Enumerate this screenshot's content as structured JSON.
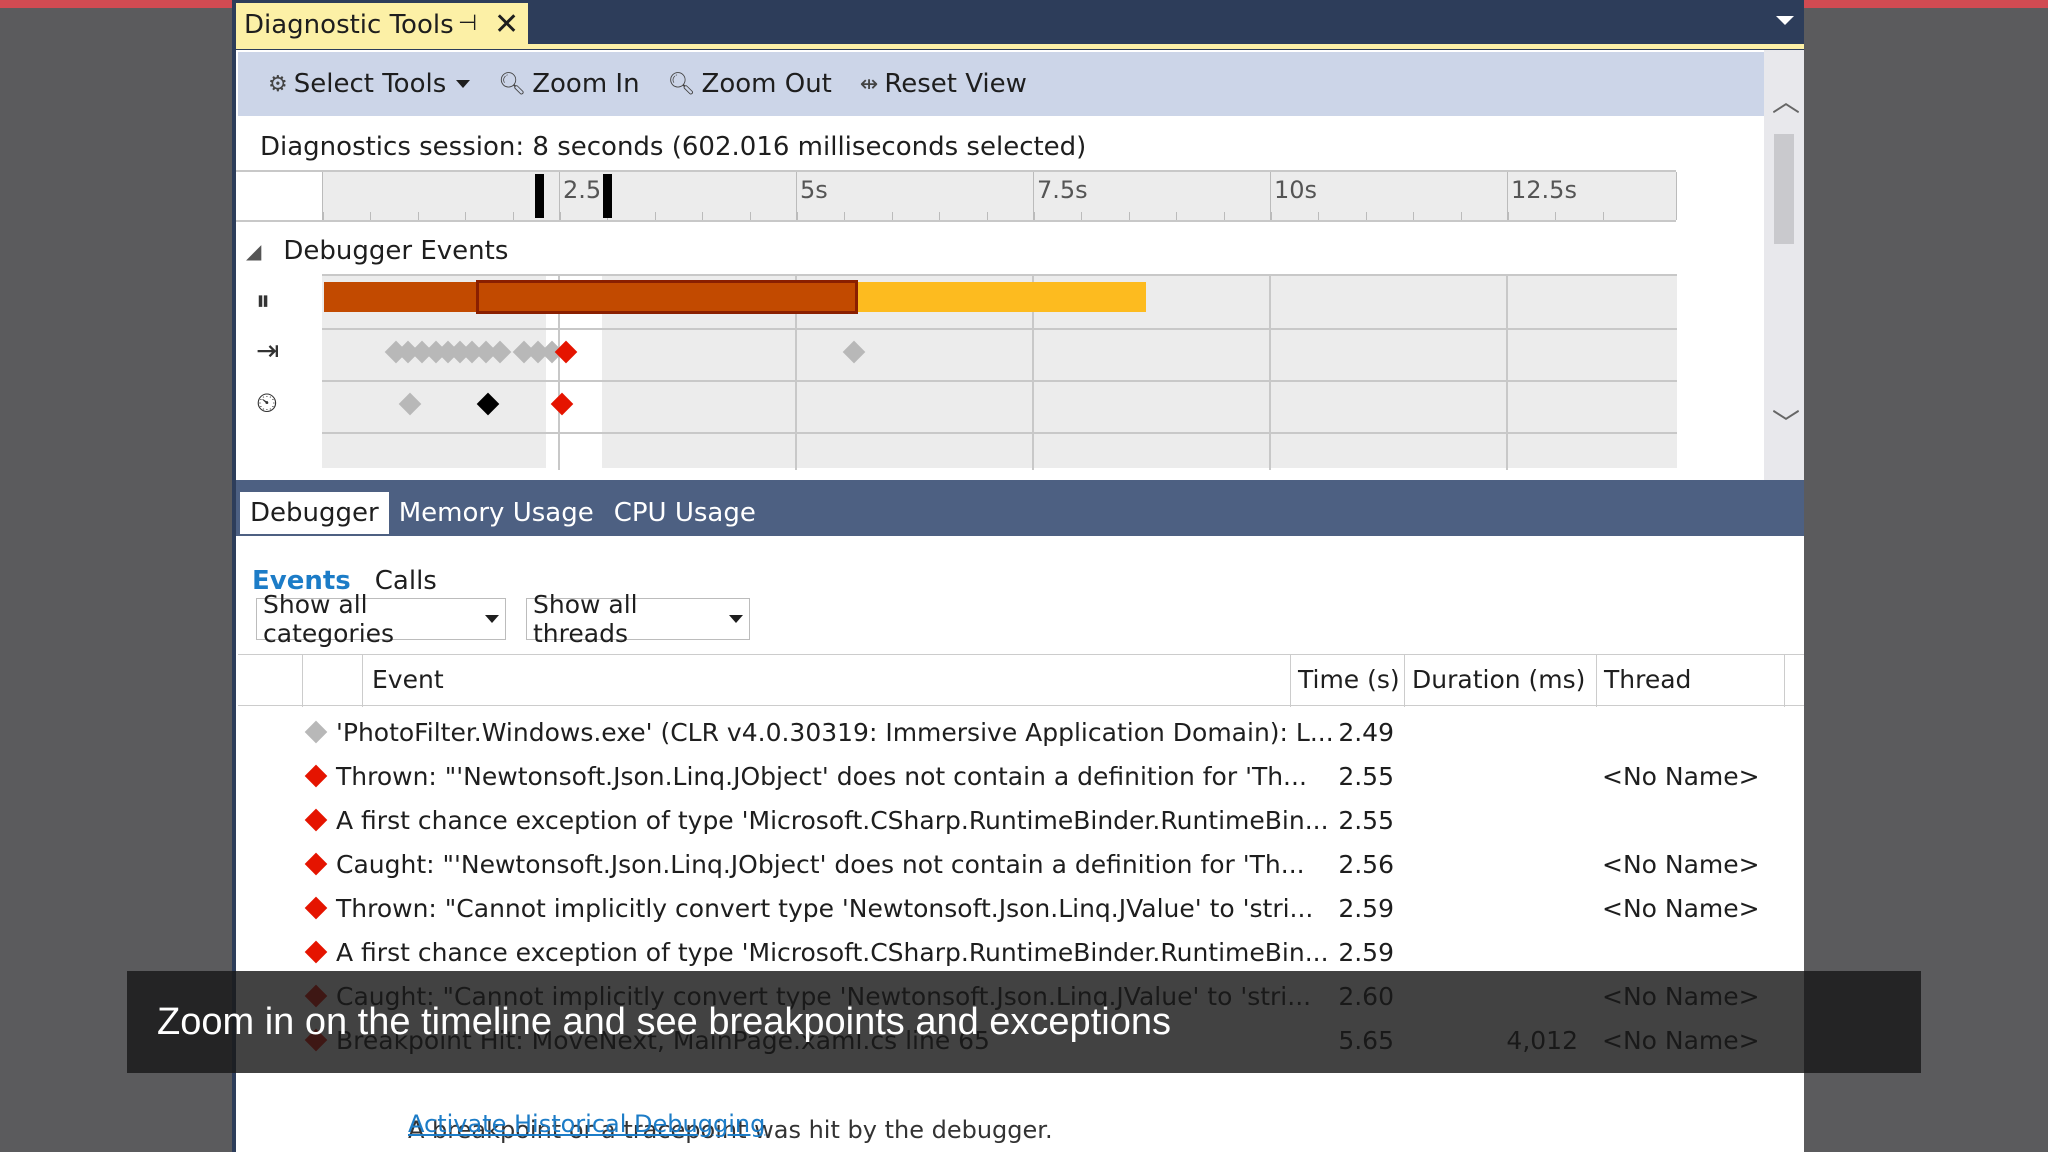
{
  "window": {
    "tab_title": "Diagnostic Tools",
    "pin_glyph": "⊣",
    "close_glyph": "✕"
  },
  "toolbar": {
    "select_tools": "Select Tools",
    "zoom_in": "Zoom In",
    "zoom_out": "Zoom Out",
    "reset_view": "Reset View"
  },
  "session": "Diagnostics session: 8 seconds (602.016 milliseconds selected)",
  "ruler": {
    "labels": [
      "2.5",
      "5s",
      "7.5s",
      "10s",
      "12.5s"
    ]
  },
  "debugger_events": {
    "header": "Debugger Events",
    "colors": {
      "break": "#c24a00",
      "running": "#fdbb1f",
      "exception": "#e51400",
      "info": "#b8b8b8",
      "breakpoint": "#000000"
    }
  },
  "bottom_tabs": [
    "Debugger",
    "Memory Usage",
    "CPU Usage"
  ],
  "sub_tabs": {
    "events": "Events",
    "calls": "Calls"
  },
  "filters": {
    "categories": "Show all categories",
    "threads": "Show all threads"
  },
  "grid": {
    "columns": [
      "Event",
      "Time (s)",
      "Duration (ms)",
      "Thread"
    ],
    "rows": [
      {
        "icon": "info",
        "event": "'PhotoFilter.Windows.exe' (CLR v4.0.30319: Immersive Application Domain): L...",
        "time": "2.49",
        "duration": "",
        "thread": ""
      },
      {
        "icon": "exception",
        "event": "Thrown: \"'Newtonsoft.Json.Linq.JObject' does not contain a definition for 'Th...",
        "time": "2.55",
        "duration": "",
        "thread": "<No Name>"
      },
      {
        "icon": "exception",
        "event": "A first chance exception of type 'Microsoft.CSharp.RuntimeBinder.RuntimeBin...",
        "time": "2.55",
        "duration": "",
        "thread": ""
      },
      {
        "icon": "exception",
        "event": "Caught: \"'Newtonsoft.Json.Linq.JObject' does not contain a definition for 'Th...",
        "time": "2.56",
        "duration": "",
        "thread": "<No Name>"
      },
      {
        "icon": "exception",
        "event": "Thrown: \"Cannot implicitly convert type 'Newtonsoft.Json.Linq.JValue' to 'stri...",
        "time": "2.59",
        "duration": "",
        "thread": "<No Name>"
      },
      {
        "icon": "exception",
        "event": "A first chance exception of type 'Microsoft.CSharp.RuntimeBinder.RuntimeBin...",
        "time": "2.59",
        "duration": "",
        "thread": ""
      },
      {
        "icon": "exception",
        "event": "Caught: \"Cannot implicitly convert type 'Newtonsoft.Json.Linq.JValue' to 'stri...",
        "time": "2.60",
        "duration": "",
        "thread": "<No Name>"
      },
      {
        "icon": "exception",
        "event": "Breakpoint Hit: MoveNext, MainPage.xaml.cs line 65",
        "time": "5.65",
        "duration": "4,012",
        "thread": "<No Name>"
      }
    ],
    "detail_text": "A breakpoint or a tracepoint was hit by the debugger.",
    "detail_link": "Activate Historical Debugging"
  },
  "caption": "Zoom in on the timeline and see breakpoints and exceptions"
}
